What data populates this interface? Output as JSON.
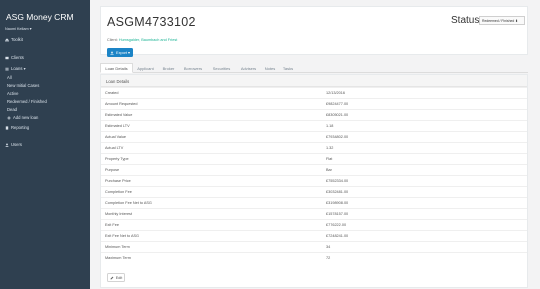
{
  "sidebar": {
    "brand": "ASG Money CRM",
    "user_label": "Naomi Kellam ▾",
    "toolbar_label": "Toolkit",
    "clients_label": "Clients",
    "loans_label": "Loans ▾",
    "loan_items": [
      "All",
      "New Initial Cases",
      "Active",
      "Redeemed / Finished",
      "Dead"
    ],
    "add_new_loan": "Add new loan",
    "reporting_label": "Reporting",
    "users_label": "Users"
  },
  "header": {
    "case_id": "ASGM4733102",
    "client_prefix": "Client:",
    "client_names": "Humsgalder, Baumbach and Friest",
    "export_label": "Export ▾",
    "status_label": "Status:",
    "status_value": "Redeemed / Finished ⬍"
  },
  "tabs": [
    "Loan Details",
    "Applicant",
    "Broker",
    "Borrowers",
    "Securities",
    "Advisers",
    "Notes",
    "Tasks"
  ],
  "details": {
    "section_title": "Loan Details",
    "rows": [
      {
        "label": "Created",
        "value": "12/13/2016"
      },
      {
        "label": "Amount Requested",
        "value": "£9824477.00"
      },
      {
        "label": "Estimated Value",
        "value": "£8305021.00"
      },
      {
        "label": "Estimated LTV",
        "value": "1.18"
      },
      {
        "label": "Actual Value",
        "value": "£7934802.00"
      },
      {
        "label": "Actual LTV",
        "value": "1.32"
      },
      {
        "label": "Property Type",
        "value": "Flat"
      },
      {
        "label": "Purpose",
        "value": "Bar"
      },
      {
        "label": "Purchase Price",
        "value": "£7552334.00"
      },
      {
        "label": "Completion Fee",
        "value": "£3032481.00"
      },
      {
        "label": "Completion Fee Net to ASG",
        "value": "£3198908.00"
      },
      {
        "label": "Monthly Interest",
        "value": "£1578157.00"
      },
      {
        "label": "Exit Fee",
        "value": "£776222.00"
      },
      {
        "label": "Exit Fee Net to ASG",
        "value": "£7248241.00"
      },
      {
        "label": "Minimum Term",
        "value": "34"
      },
      {
        "label": "Maximum Term",
        "value": "72"
      }
    ],
    "edit_label": "Edit"
  }
}
